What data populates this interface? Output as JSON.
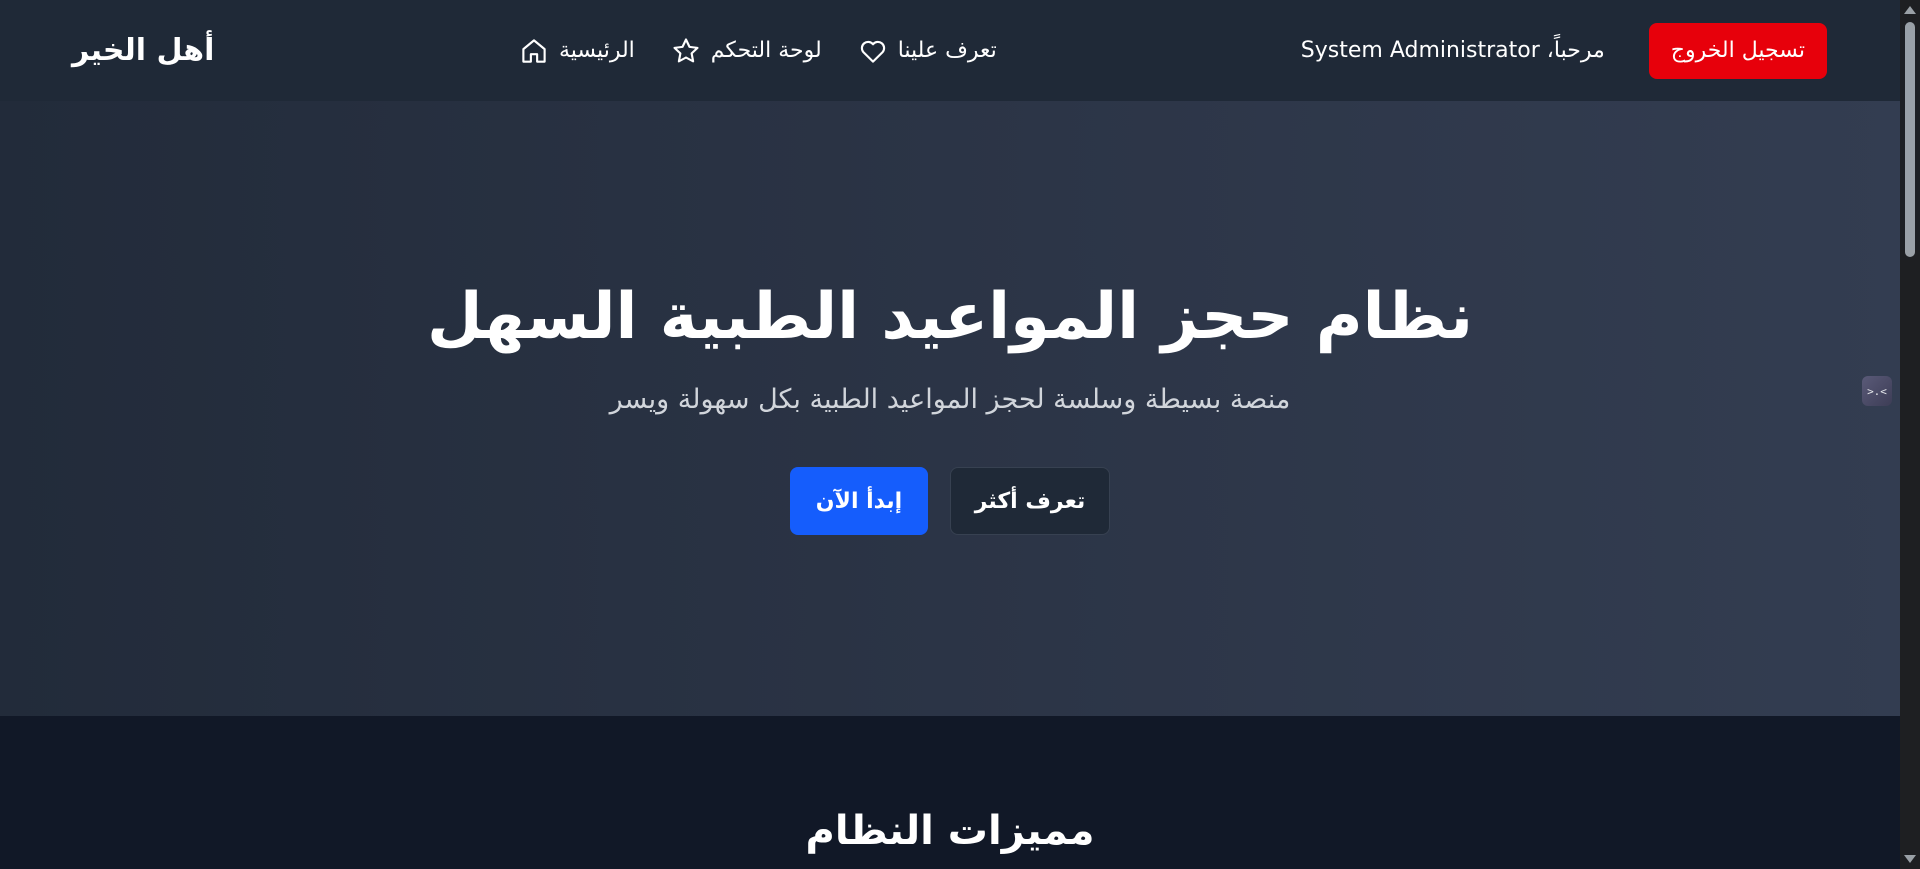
{
  "navbar": {
    "brand": "أهل الخير",
    "links": [
      {
        "label": "الرئيسية",
        "icon": "home-icon"
      },
      {
        "label": "لوحة التحكم",
        "icon": "star-icon"
      },
      {
        "label": "تعرف علينا",
        "icon": "heart-icon"
      }
    ],
    "welcome": "مرحباً، System Administrator",
    "logout_label": "تسجيل الخروج"
  },
  "hero": {
    "title": "نظام حجز المواعيد الطبية السهل",
    "subtitle": "منصة بسيطة وسلسة لحجز المواعيد الطبية بكل سهولة ويسر",
    "primary_button": "إبدأ الآن",
    "secondary_button": "تعرف أكثر"
  },
  "features": {
    "title": "مميزات النظام"
  },
  "widget": {
    "glyph": ">.<"
  },
  "colors": {
    "navbar_bg": "#1f2937",
    "hero_bg": "#2c3547",
    "page_bg": "#111827",
    "logout": "#e7000b",
    "primary": "#155dfc"
  }
}
